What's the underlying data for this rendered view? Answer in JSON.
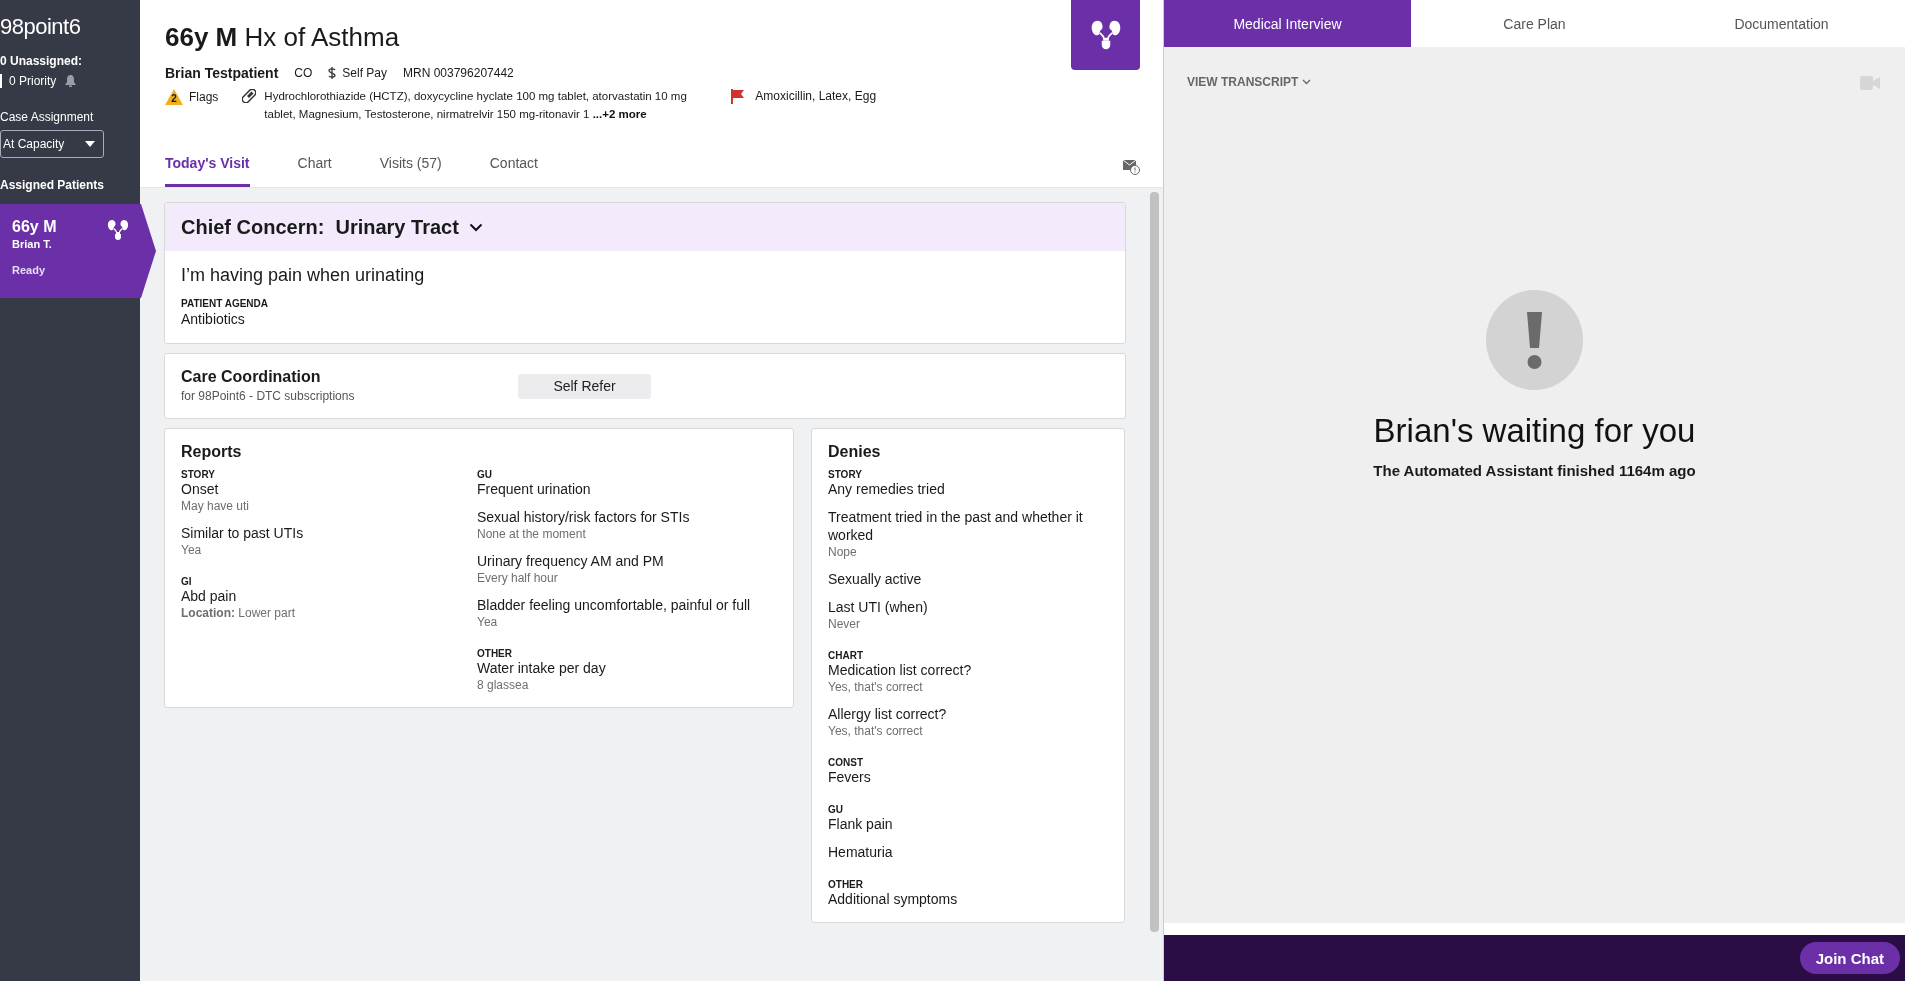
{
  "sidebar": {
    "logo": "98point6",
    "unassigned": "0 Unassigned:",
    "priority": "0 Priority",
    "case_assignment_label": "Case Assignment",
    "case_assignment_value": "At Capacity",
    "assigned_label": "Assigned Patients",
    "patients": [
      {
        "age_sex": "66y M",
        "name": "Brian T.",
        "status": "Ready",
        "selected": true
      }
    ]
  },
  "header": {
    "title": "**66y M** Hx of Asthma",
    "patient_name": "Brian Testpatient",
    "state": "CO",
    "payment": "Self Pay",
    "mrn": "MRN 003796207442",
    "flag_count": "2",
    "flags_label": "Flags",
    "medications": "Hydrochlorothiazide (HCTZ), doxycycline hyclate 100 mg tablet, atorvastatin 10 mg tablet, Magnesium, Testosterone, nirmatrelvir 150 mg-ritonavir 1",
    "medications_more": "...+2 more",
    "allergies": "Amoxicillin, Latex, Egg"
  },
  "tabs": [
    {
      "label": "Today's Visit",
      "selected": true
    },
    {
      "label": "Chart",
      "selected": false
    },
    {
      "label": "Visits (57)",
      "selected": false
    },
    {
      "label": "Contact",
      "selected": false
    }
  ],
  "chief_concern": {
    "label": "Chief Concern:",
    "topic": "Urinary Tract",
    "quote": "I’m having pain when urinating",
    "agenda_label": "PATIENT AGENDA",
    "agenda": "Antibiotics"
  },
  "care_coordination": {
    "title": "Care Coordination",
    "subtitle": "for 98Point6 - DTC subscriptions",
    "button": "Self Refer"
  },
  "reports": {
    "title": "Reports",
    "columns": [
      [
        {
          "heading": "STORY",
          "items": [
            {
              "label": "Onset",
              "detail": "May have uti"
            },
            {
              "label": "Similar to past UTIs",
              "detail": "Yea"
            }
          ]
        },
        {
          "heading": "GI",
          "items": [
            {
              "label": "Abd pain",
              "detail": "**Location:** Lower part"
            }
          ]
        }
      ],
      [
        {
          "heading": "GU",
          "items": [
            {
              "label": "Frequent urination"
            },
            {
              "label": "Sexual history/risk factors for STIs",
              "detail": "None at the moment"
            },
            {
              "label": "Urinary frequency AM and PM",
              "detail": "Every half hour"
            },
            {
              "label": "Bladder feeling uncomfortable, painful or full",
              "detail": "Yea"
            }
          ]
        },
        {
          "heading": "OTHER",
          "items": [
            {
              "label": "Water intake per day",
              "detail": "8 glassea"
            }
          ]
        }
      ]
    ]
  },
  "denies": {
    "title": "Denies",
    "groups": [
      {
        "heading": "STORY",
        "items": [
          {
            "label": "Any remedies tried"
          },
          {
            "label": "Treatment tried in the past and whether it worked",
            "detail": "Nope"
          },
          {
            "label": "Sexually active"
          },
          {
            "label": "Last UTI (when)",
            "detail": "Never"
          }
        ]
      },
      {
        "heading": "CHART",
        "items": [
          {
            "label": "Medication list correct?",
            "detail": "Yes, that's correct"
          },
          {
            "label": "Allergy list correct?",
            "detail": "Yes, that's correct"
          }
        ]
      },
      {
        "heading": "CONST",
        "items": [
          {
            "label": "Fevers"
          }
        ]
      },
      {
        "heading": "GU",
        "items": [
          {
            "label": "Flank pain"
          },
          {
            "label": "Hematuria"
          }
        ]
      },
      {
        "heading": "OTHER",
        "items": [
          {
            "label": "Additional symptoms"
          }
        ]
      }
    ]
  },
  "interview": {
    "tabs": [
      {
        "label": "Medical Interview",
        "selected": true
      },
      {
        "label": "Care Plan",
        "selected": false
      },
      {
        "label": "Documentation",
        "selected": false
      }
    ],
    "transcript_link": "VIEW TRANSCRIPT",
    "waiting_title": "Brian's waiting for you",
    "waiting_subtitle": "The Automated Assistant finished 1164m ago",
    "join_button": "Join Chat"
  }
}
